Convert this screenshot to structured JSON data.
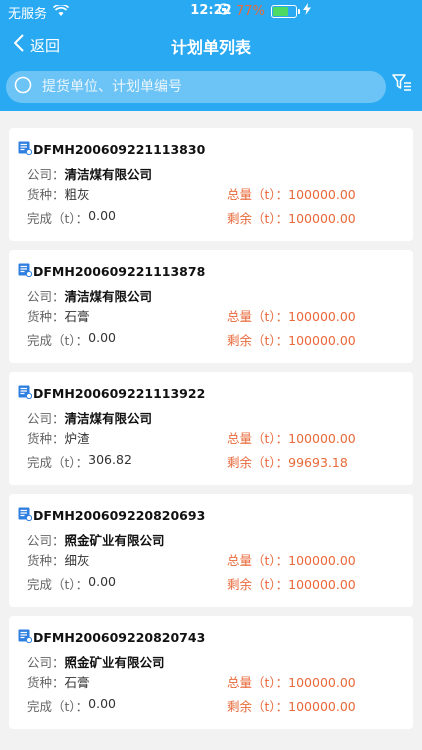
{
  "status": {
    "carrier": "无服务",
    "time": "12:22",
    "battery": "77%",
    "battery_level": 0.77
  },
  "nav": {
    "back_label": "返回",
    "title": "计划单列表"
  },
  "search": {
    "placeholder": "提货单位、计划单编号"
  },
  "labels": {
    "company": "公司：",
    "cargo": "货种：",
    "done": "完成（t）：",
    "total": "总量（t）：",
    "remain": "剩余（t）："
  },
  "plans": [
    {
      "code": "DFMH200609221113830",
      "company": "清洁煤有限公司",
      "cargo": "粗灰",
      "done": "0.00",
      "total": "100000.00",
      "remain": "100000.00"
    },
    {
      "code": "DFMH200609221113878",
      "company": "清洁煤有限公司",
      "cargo": "石膏",
      "done": "0.00",
      "total": "100000.00",
      "remain": "100000.00"
    },
    {
      "code": "DFMH200609221113922",
      "company": "清洁煤有限公司",
      "cargo": "炉渣",
      "done": "306.82",
      "total": "100000.00",
      "remain": "99693.18"
    },
    {
      "code": "DFMH200609220820693",
      "company": "照金矿业有限公司",
      "cargo": "细灰",
      "done": "0.00",
      "total": "100000.00",
      "remain": "100000.00"
    },
    {
      "code": "DFMH200609220820743",
      "company": "照金矿业有限公司",
      "cargo": "石膏",
      "done": "0.00",
      "total": "100000.00",
      "remain": "100000.00"
    }
  ],
  "colors": {
    "header": "#29a9f2",
    "accent": "#e8693a",
    "doc_icon": "#2f7fe0"
  }
}
